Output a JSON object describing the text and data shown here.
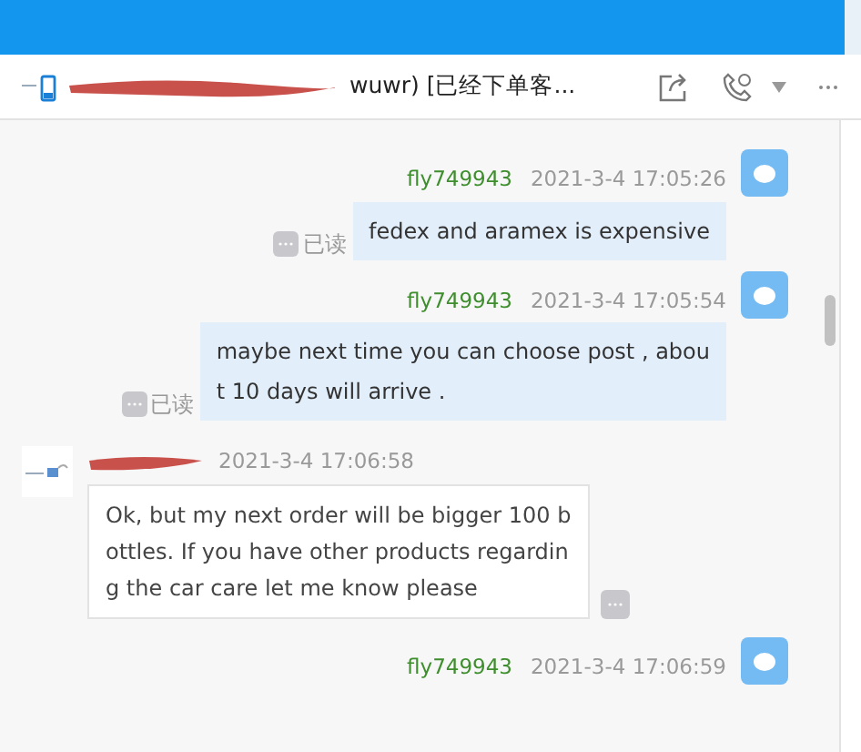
{
  "header": {
    "title_visible": "wuwr) [已经下单客...",
    "redacted": true
  },
  "messages": [
    {
      "kind": "outgoing",
      "sender": "fly749943",
      "time": "2021-3-4 17:05:26",
      "lines": [
        "fedex and aramex is expensive"
      ],
      "read_label": "已读"
    },
    {
      "kind": "outgoing",
      "sender": "fly749943",
      "time": "2021-3-4 17:05:54",
      "lines": [
        "maybe next time you can choose post , abou",
        "t 10 days will arrive ."
      ],
      "read_label": "已读"
    },
    {
      "kind": "incoming",
      "sender_redacted": true,
      "time": "2021-3-4 17:06:58",
      "lines": [
        "Ok, but my next order will be bigger 100 b",
        "ottles. If you have other products regardin",
        "g the car care let me know please"
      ]
    },
    {
      "kind": "outgoing",
      "sender": "fly749943",
      "time": "2021-3-4 17:06:59"
    }
  ]
}
